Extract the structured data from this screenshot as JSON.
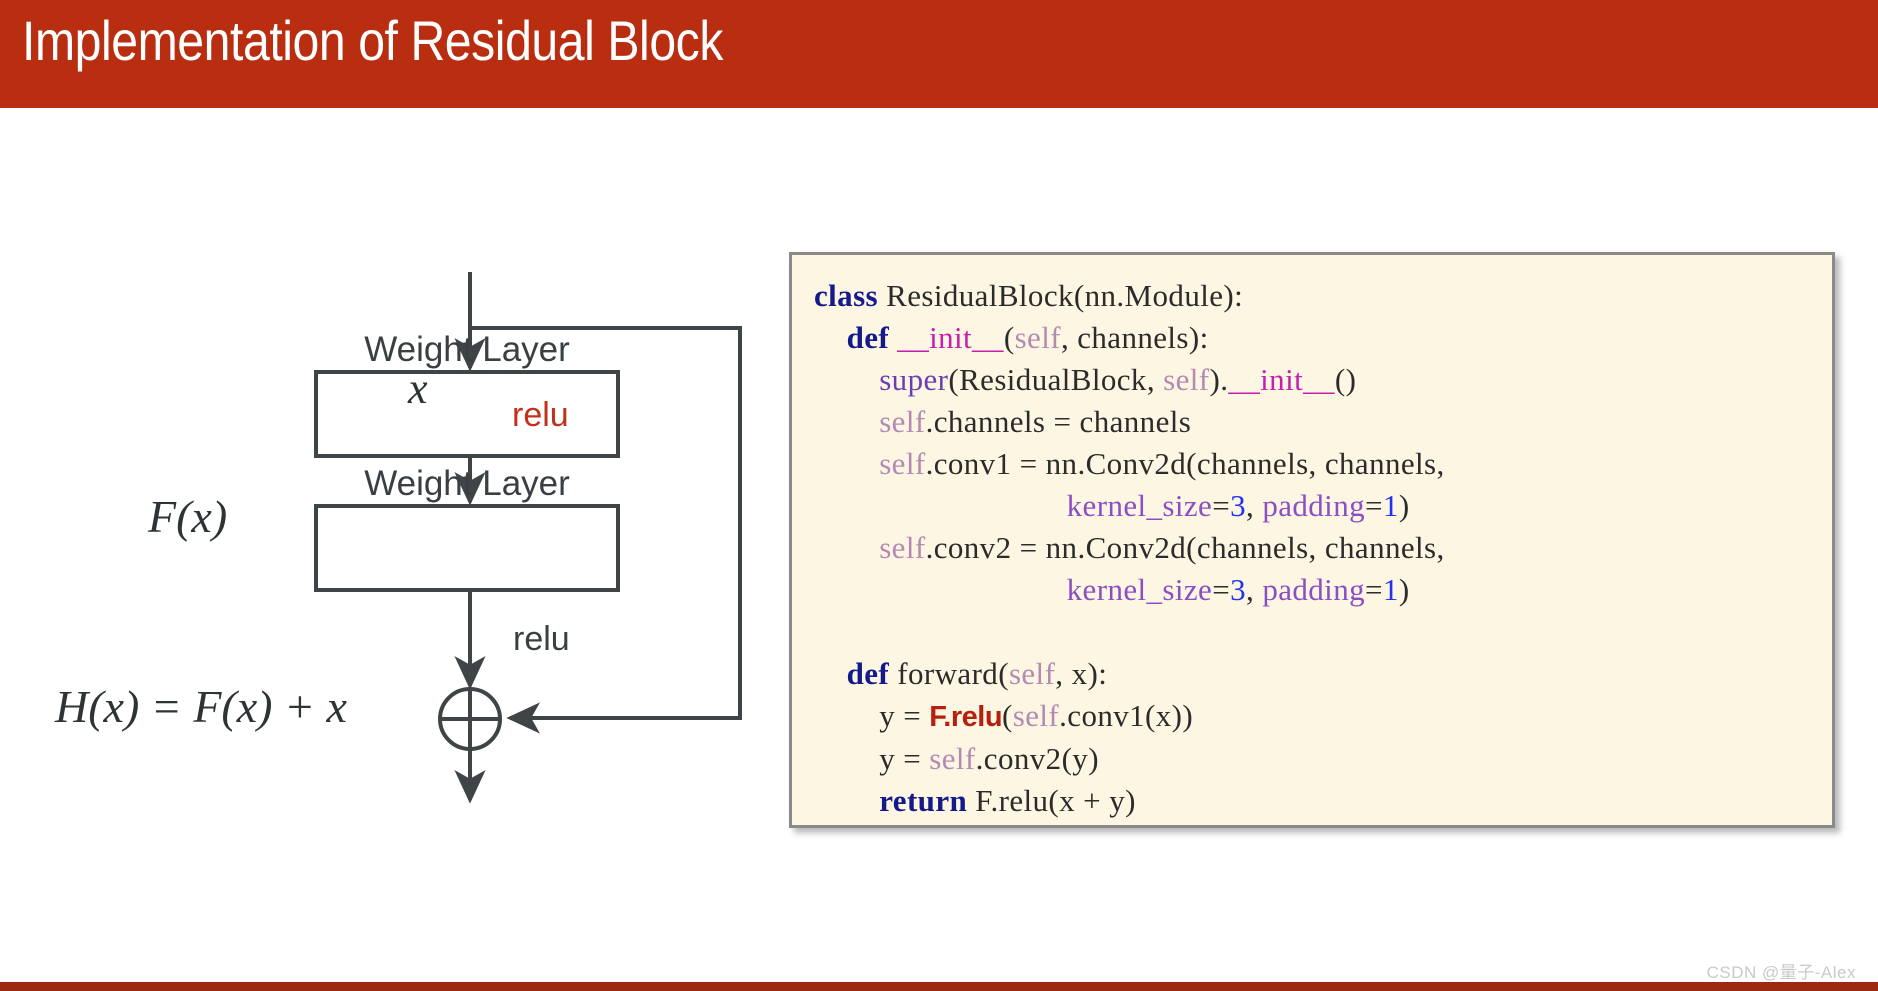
{
  "header": {
    "title": "Implementation of Residual Block",
    "bar_color": "#b92e11"
  },
  "footer": {
    "watermark": "CSDN @量子-Alex",
    "accent_color": "#9c2a10"
  },
  "diagram": {
    "input_label": "x",
    "residual_label": "F(x)",
    "output_equation": "H(x) = F(x) + x",
    "relu_top": "relu",
    "relu_bottom": "relu",
    "relu_top_color": "#c0321c",
    "relu_bottom_color": "#3a3f43",
    "blocks": [
      {
        "label": "Weight Layer"
      },
      {
        "label": "Weight Layer"
      }
    ],
    "sum_node": "plus-circle",
    "line_color": "#3f4447"
  },
  "code_panel": {
    "background": "#fdf6e3",
    "border_color": "#8a8a8a",
    "language": "python",
    "lines": [
      "class ResidualBlock(nn.Module):",
      "    def __init__(self, channels):",
      "        super(ResidualBlock, self).__init__()",
      "        self.channels = channels",
      "        self.conv1 = nn.Conv2d(channels, channels,",
      "                               kernel_size=3, padding=1)",
      "        self.conv2 = nn.Conv2d(channels, channels,",
      "                               kernel_size=3, padding=1)",
      "",
      "    def forward(self, x):",
      "        y = F.relu(self.conv1(x))",
      "        y = self.conv2(y)",
      "        return F.relu(x + y)"
    ],
    "highlighted_token": "F.relu",
    "syntax_colors": {
      "keyword": "#141a8c",
      "dunder": "#c61fb0",
      "self": "#b48ab4",
      "function": "#6a3fb5",
      "kwarg": "#8a4fc4",
      "number": "#2432f0",
      "plain": "#2b2b2b",
      "highlight": "#b5200f"
    }
  }
}
